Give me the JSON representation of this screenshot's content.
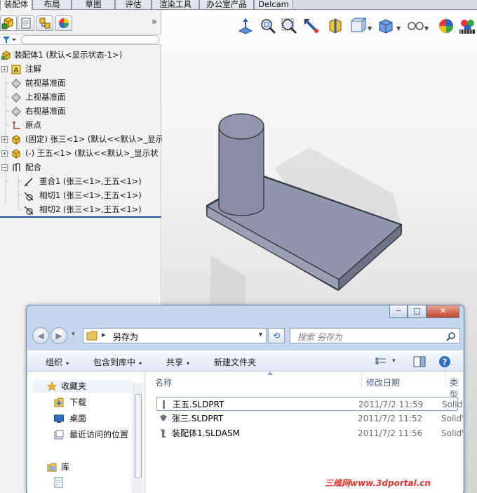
{
  "tabs": [
    "装配体",
    "布局",
    "草图",
    "评估",
    "渲染工具",
    "办公室产品",
    "Delcam"
  ],
  "feature_manager": {
    "tab_icons": [
      "feature-manager-tab-icon",
      "property-manager-tab-icon",
      "configuration-manager-tab-icon",
      "display-manager-tab-icon"
    ],
    "expand_label": "»",
    "filter_icon": "filter-icon",
    "tree": [
      {
        "label": "装配体1  (默认<显示状态-1>)",
        "icon": "assembly-icon",
        "indent": 0,
        "expander": false
      },
      {
        "label": "注解",
        "icon": "annotations-icon",
        "indent": 1,
        "expander": true
      },
      {
        "label": "前视基准面",
        "icon": "plane-icon",
        "indent": 1,
        "expander": false
      },
      {
        "label": "上视基准面",
        "icon": "plane-icon",
        "indent": 1,
        "expander": false
      },
      {
        "label": "右视基准面",
        "icon": "plane-icon",
        "indent": 1,
        "expander": false
      },
      {
        "label": "原点",
        "icon": "origin-icon",
        "indent": 1,
        "expander": false
      },
      {
        "label": "(固定) 张三<1> (默认<<默认>_显示",
        "icon": "part-icon",
        "indent": 1,
        "expander": true
      },
      {
        "label": "(-) 王五<1> (默认<<默认>_显示状",
        "icon": "part-icon",
        "indent": 1,
        "expander": true
      },
      {
        "label": "配合",
        "icon": "mates-icon",
        "indent": 1,
        "expander": true
      },
      {
        "label": "重合1 (张三<1>,王五<1>)",
        "icon": "coincident-mate-icon",
        "indent": 2,
        "expander": false
      },
      {
        "label": "相切1 (张三<1>,王五<1>)",
        "icon": "tangent-mate-icon",
        "indent": 2,
        "expander": false
      },
      {
        "label": "相切2 (张三<1>,王五<1>)",
        "icon": "tangent-mate-icon",
        "indent": 2,
        "expander": false
      }
    ]
  },
  "view_toolbar": [
    "view-orientation-icon",
    "zoom-to-fit-icon",
    "zoom-to-area-icon",
    "previous-view-icon",
    "section-view-icon",
    "view-orientation-dropdown-icon",
    "display-style-icon",
    "hide-show-icon",
    "appearance-icon",
    "scene-icon"
  ],
  "dialog": {
    "title_buttons": {
      "minimize": "─",
      "maximize": "□",
      "close": "✕"
    },
    "back_label": "◀",
    "forward_label": "▶",
    "history_caret": "▾",
    "address_sep": "▸",
    "address": "另存为",
    "address_caret": "▾",
    "refresh_label": "⟲",
    "search_placeholder": "搜索 另存为",
    "toolbar": {
      "organize": "组织",
      "include_in_library": "包含到库中",
      "share": "共享",
      "new_folder": "新建文件夹",
      "caret": "▾"
    },
    "nav": {
      "favorites": "收藏夹",
      "downloads": "下载",
      "desktop": "桌面",
      "recent": "最近访问的位置",
      "libraries": "库"
    },
    "columns": {
      "name": "名称",
      "date": "修改日期",
      "type": "类型"
    },
    "files": [
      {
        "name": "王五.SLDPRT",
        "date": "2011/7/2 11:59",
        "type": "SolidWorks",
        "icon": "part-file-icon",
        "selected": true
      },
      {
        "name": "张三.SLDPRT",
        "date": "2011/7/2 11:52",
        "type": "SolidWorks",
        "icon": "part-file-icon",
        "selected": false
      },
      {
        "name": "装配体1.SLDASM",
        "date": "2011/7/2 11:56",
        "type": "SolidWorks",
        "icon": "assembly-file-icon",
        "selected": false
      }
    ]
  },
  "watermark": "三维网www.3dportal.cn",
  "colors": {
    "accent": "#1f4f96",
    "model": "#8e96ab",
    "watermark": "#e8342d"
  }
}
